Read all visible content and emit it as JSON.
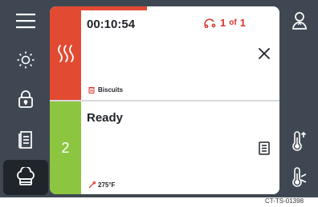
{
  "cook_slot_1": {
    "timer": "00:10:54",
    "batch_current": "1",
    "batch_of": "of",
    "batch_total": "1",
    "item_name": "Biscuits",
    "progress_fraction": 0.33,
    "strip_color": "#e24a32",
    "strip_icon": "heat-waves-icon"
  },
  "cook_slot_2": {
    "status": "Ready",
    "slot_number": "2",
    "temperature": "275°F",
    "strip_color": "#8cc540"
  },
  "left_rail": [
    "menu-icon",
    "brightness-icon",
    "lock-icon",
    "recipe-book-icon",
    "chef-hat-icon"
  ],
  "right_rail": [
    "user-icon",
    "temperature-up-icon",
    "temperature-icon"
  ],
  "caption": "CT-TS-01398"
}
